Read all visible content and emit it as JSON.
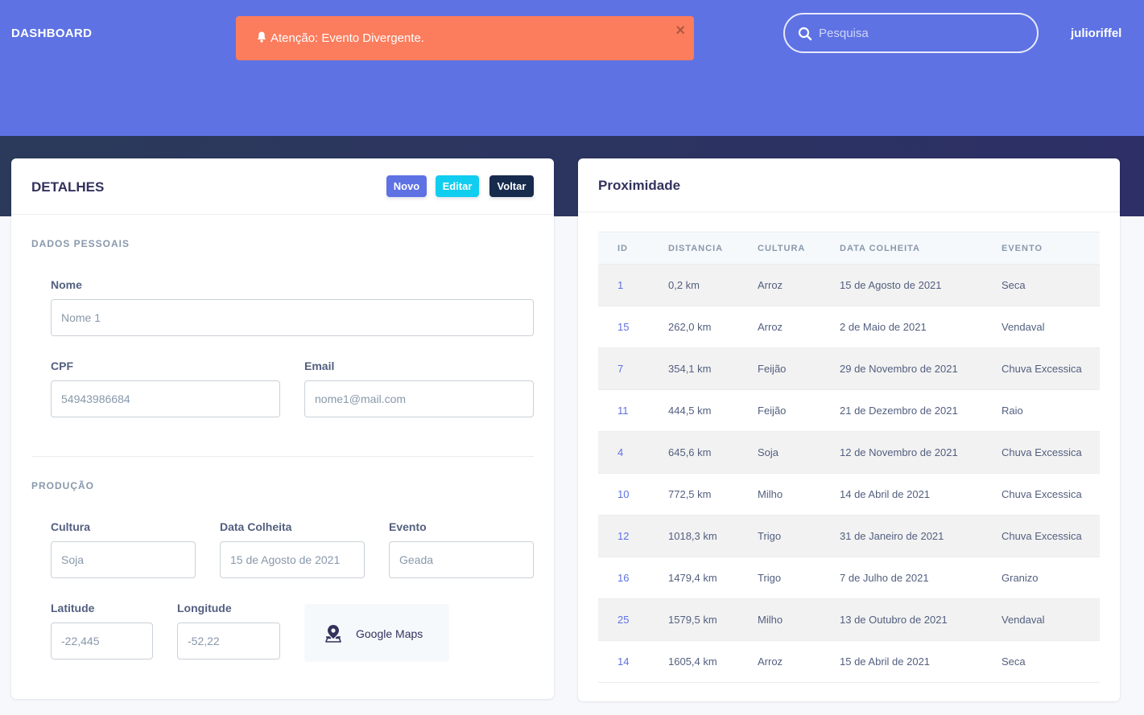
{
  "header": {
    "brand": "DASHBOARD",
    "alert": {
      "message": "Atenção: Evento Divergente.",
      "close": "×"
    },
    "search": {
      "placeholder": "Pesquisa"
    },
    "user": "julioriffel"
  },
  "details": {
    "title": "DETALHES",
    "buttons": {
      "new": "Novo",
      "edit": "Editar",
      "back": "Voltar"
    },
    "personal_section": "DADOS PESSOAIS",
    "name": {
      "label": "Nome",
      "value": "Nome 1"
    },
    "cpf": {
      "label": "CPF",
      "value": "54943986684"
    },
    "email": {
      "label": "Email",
      "value": "nome1@mail.com"
    },
    "production_section": "PRODUÇÃO",
    "culture": {
      "label": "Cultura",
      "value": "Soja"
    },
    "harvest_date": {
      "label": "Data Colheita",
      "value": "15 de Agosto de 2021"
    },
    "event": {
      "label": "Evento",
      "value": "Geada"
    },
    "latitude": {
      "label": "Latitude",
      "value": "-22,445"
    },
    "longitude": {
      "label": "Longitude",
      "value": "-52,22"
    },
    "maps_button": "Google Maps"
  },
  "proximity": {
    "title": "Proximidade",
    "columns": [
      "ID",
      "DISTANCIA",
      "CULTURA",
      "DATA COLHEITA",
      "EVENTO"
    ],
    "rows": [
      [
        "1",
        "0,2 km",
        "Arroz",
        "15 de Agosto de 2021",
        "Seca"
      ],
      [
        "15",
        "262,0 km",
        "Arroz",
        "2 de Maio de 2021",
        "Vendaval"
      ],
      [
        "7",
        "354,1 km",
        "Feijão",
        "29 de Novembro de 2021",
        "Chuva Excessica"
      ],
      [
        "11",
        "444,5 km",
        "Feijão",
        "21 de Dezembro de 2021",
        "Raio"
      ],
      [
        "4",
        "645,6 km",
        "Soja",
        "12 de Novembro de 2021",
        "Chuva Excessica"
      ],
      [
        "10",
        "772,5 km",
        "Milho",
        "14 de Abril de 2021",
        "Chuva Excessica"
      ],
      [
        "12",
        "1018,3 km",
        "Trigo",
        "31 de Janeiro de 2021",
        "Chuva Excessica"
      ],
      [
        "16",
        "1479,4 km",
        "Trigo",
        "7 de Julho de 2021",
        "Granizo"
      ],
      [
        "25",
        "1579,5 km",
        "Milho",
        "13 de Outubro de 2021",
        "Vendaval"
      ],
      [
        "14",
        "1605,4 km",
        "Arroz",
        "15 de Abril de 2021",
        "Seca"
      ]
    ]
  },
  "colors": {
    "primary": "#5e72e4",
    "info": "#11cdef",
    "dark": "#172b4d",
    "warning": "#fb7d5d"
  }
}
